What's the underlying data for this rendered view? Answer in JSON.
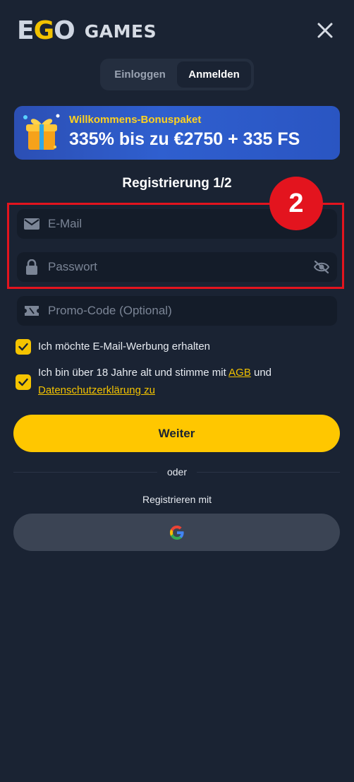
{
  "header": {
    "logo_text": "EGO",
    "logo_games": "GAMES",
    "close_icon": "close-icon"
  },
  "tabs": [
    {
      "label": "Einloggen",
      "active": false
    },
    {
      "label": "Anmelden",
      "active": true
    }
  ],
  "banner": {
    "title": "Willkommens-Bonuspaket",
    "offer": "335% bis zu €2750 + 335 FS",
    "icon": "gift-icon"
  },
  "form": {
    "step_title": "Registrierung",
    "step_count": "1/2",
    "email_placeholder": "E-Mail",
    "password_placeholder": "Passwort",
    "promo_placeholder": "Promo-Code (Optional)"
  },
  "annotation": {
    "badge_number": "2",
    "color": "#e3141e"
  },
  "consents": {
    "email_ads": "Ich möchte E-Mail-Werbung erhalten",
    "terms_prefix": "Ich bin über 18 Jahre alt und stimme mit",
    "terms_link": "AGB",
    "terms_and": "und",
    "privacy_link": "Datenschutzerklärung zu",
    "email_ads_checked": true,
    "terms_checked": true
  },
  "actions": {
    "continue": "Weiter",
    "or": "oder",
    "register_with": "Registrieren mit",
    "google_icon": "google-icon"
  },
  "colors": {
    "background": "#1a2333",
    "accent": "#ffc700",
    "input": "#141c29",
    "banner": "#2f5fcf"
  }
}
